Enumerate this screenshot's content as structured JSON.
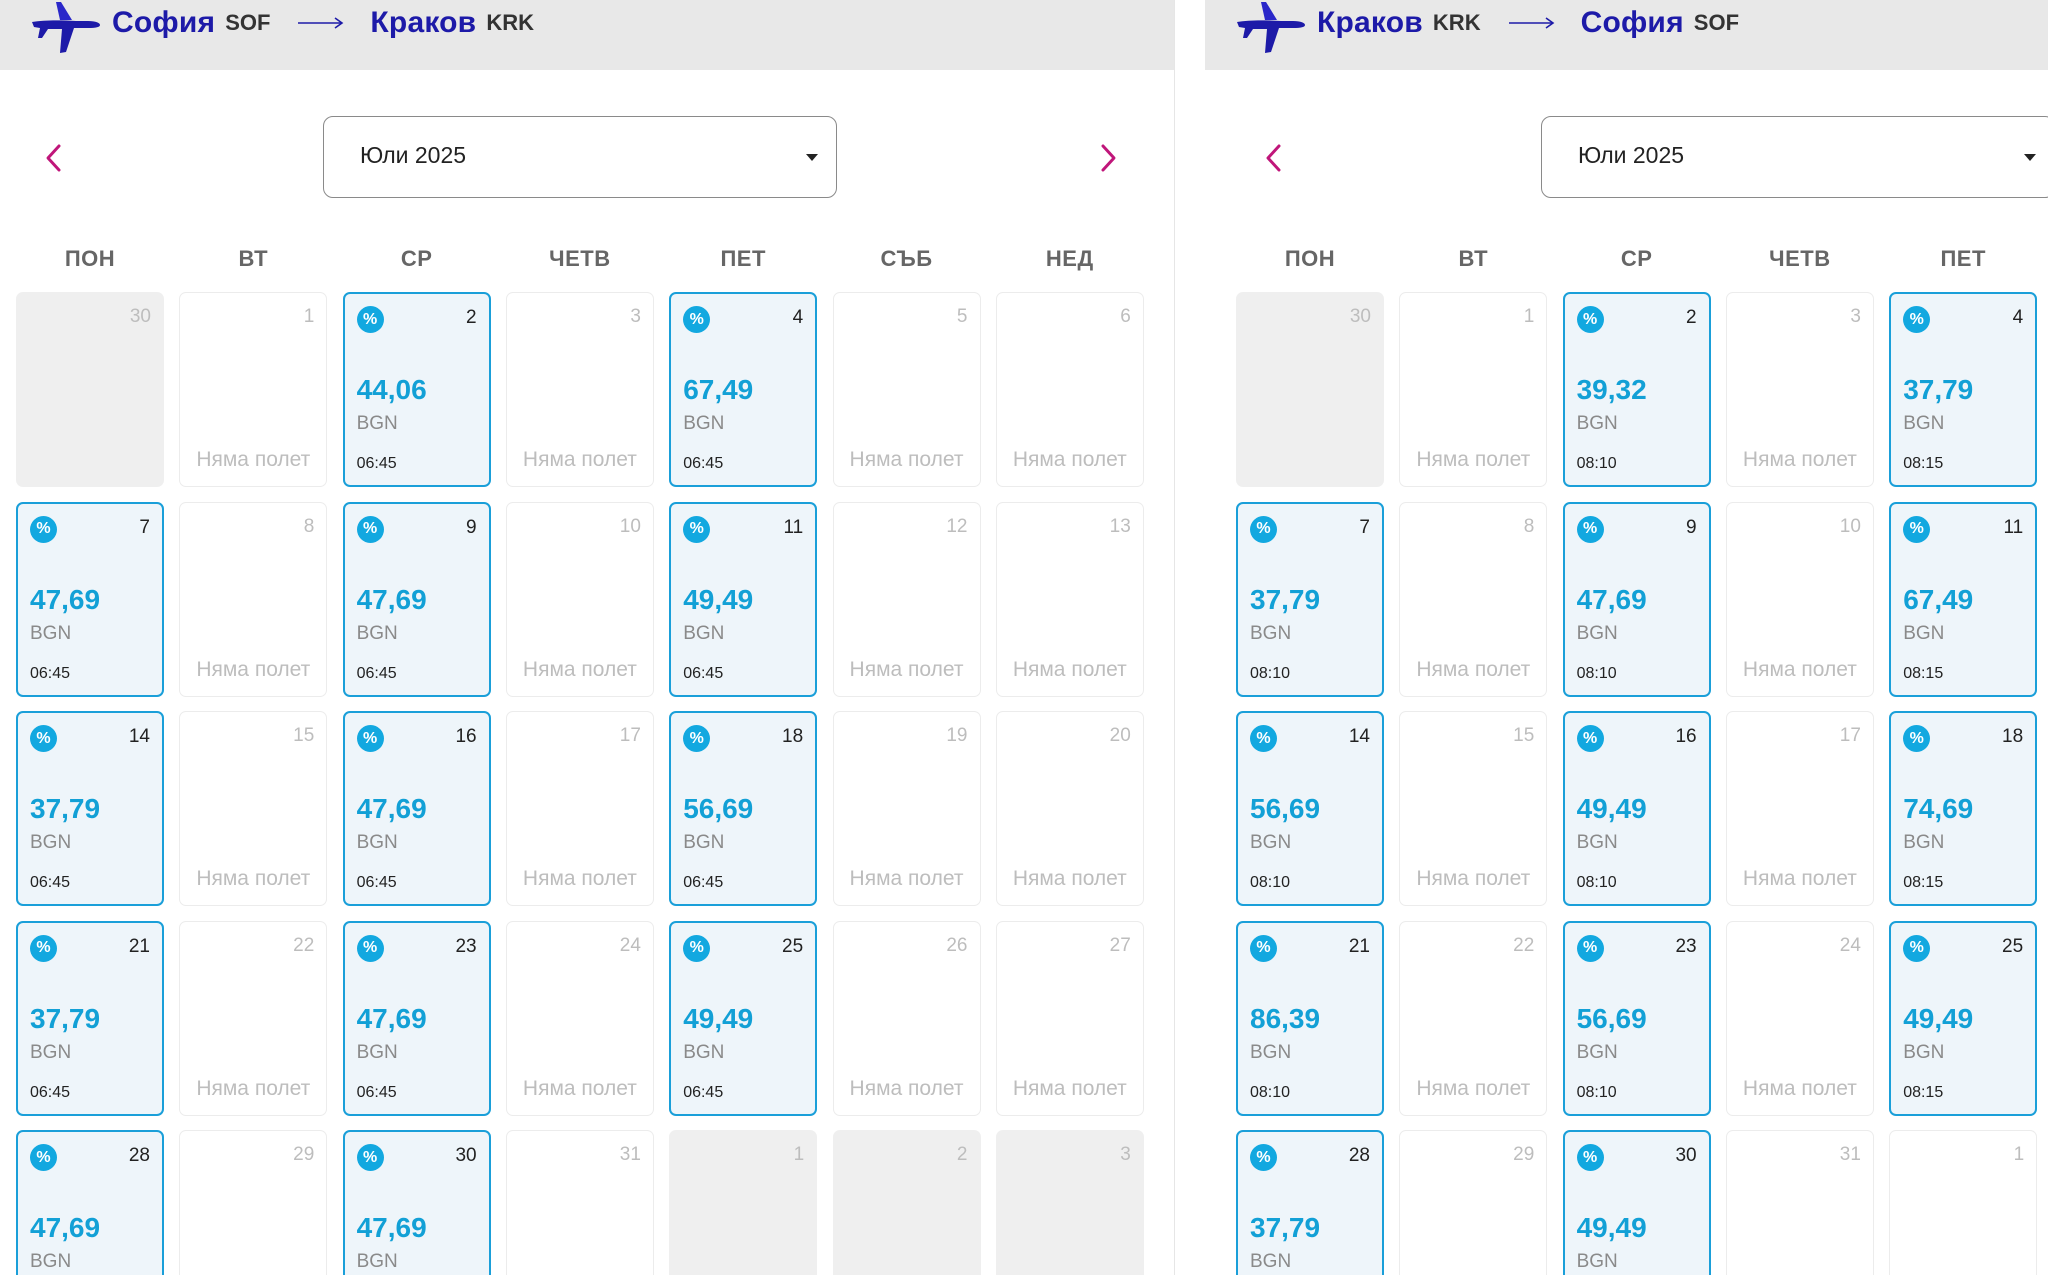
{
  "colors": {
    "accent": "#12a0d6",
    "brand": "#1d1aa8",
    "nav": "#c0167a",
    "header_bg": "#e8e8e8"
  },
  "no_flight_label": "Няма полет",
  "currency": "BGN",
  "discount_badge": "%",
  "panels": [
    {
      "origin_city": "София",
      "origin_code": "SOF",
      "dest_city": "Краков",
      "dest_code": "KRK",
      "month": "Юли 2025",
      "weekdays": [
        "ПОН",
        "ВТ",
        "СР",
        "ЧЕТВ",
        "ПЕТ",
        "СЪБ",
        "НЕД"
      ],
      "days": [
        {
          "day": "30",
          "state": "empty"
        },
        {
          "day": "1",
          "state": "none"
        },
        {
          "day": "2",
          "state": "flight",
          "price": "44,06",
          "time": "06:45"
        },
        {
          "day": "3",
          "state": "none"
        },
        {
          "day": "4",
          "state": "flight",
          "price": "67,49",
          "time": "06:45"
        },
        {
          "day": "5",
          "state": "none"
        },
        {
          "day": "6",
          "state": "none"
        },
        {
          "day": "7",
          "state": "flight",
          "price": "47,69",
          "time": "06:45"
        },
        {
          "day": "8",
          "state": "none"
        },
        {
          "day": "9",
          "state": "flight",
          "price": "47,69",
          "time": "06:45"
        },
        {
          "day": "10",
          "state": "none"
        },
        {
          "day": "11",
          "state": "flight",
          "price": "49,49",
          "time": "06:45"
        },
        {
          "day": "12",
          "state": "none"
        },
        {
          "day": "13",
          "state": "none"
        },
        {
          "day": "14",
          "state": "flight",
          "price": "37,79",
          "time": "06:45"
        },
        {
          "day": "15",
          "state": "none"
        },
        {
          "day": "16",
          "state": "flight",
          "price": "47,69",
          "time": "06:45"
        },
        {
          "day": "17",
          "state": "none"
        },
        {
          "day": "18",
          "state": "flight",
          "price": "56,69",
          "time": "06:45"
        },
        {
          "day": "19",
          "state": "none"
        },
        {
          "day": "20",
          "state": "none"
        },
        {
          "day": "21",
          "state": "flight",
          "price": "37,79",
          "time": "06:45"
        },
        {
          "day": "22",
          "state": "none"
        },
        {
          "day": "23",
          "state": "flight",
          "price": "47,69",
          "time": "06:45"
        },
        {
          "day": "24",
          "state": "none"
        },
        {
          "day": "25",
          "state": "flight",
          "price": "49,49",
          "time": "06:45"
        },
        {
          "day": "26",
          "state": "none"
        },
        {
          "day": "27",
          "state": "none"
        },
        {
          "day": "28",
          "state": "flight",
          "price": "47,69",
          "time": ""
        },
        {
          "day": "29",
          "state": "none"
        },
        {
          "day": "30",
          "state": "flight",
          "price": "47,69",
          "time": ""
        },
        {
          "day": "31",
          "state": "none"
        },
        {
          "day": "1",
          "state": "empty"
        },
        {
          "day": "2",
          "state": "empty"
        },
        {
          "day": "3",
          "state": "empty"
        }
      ]
    },
    {
      "origin_city": "Краков",
      "origin_code": "KRK",
      "dest_city": "София",
      "dest_code": "SOF",
      "month": "Юли 2025",
      "weekdays": [
        "ПОН",
        "ВТ",
        "СР",
        "ЧЕТВ",
        "ПЕТ"
      ],
      "days": [
        {
          "day": "30",
          "state": "empty"
        },
        {
          "day": "1",
          "state": "none"
        },
        {
          "day": "2",
          "state": "flight",
          "price": "39,32",
          "time": "08:10"
        },
        {
          "day": "3",
          "state": "none"
        },
        {
          "day": "4",
          "state": "flight",
          "price": "37,79",
          "time": "08:15"
        },
        {
          "day": "7",
          "state": "flight",
          "price": "37,79",
          "time": "08:10"
        },
        {
          "day": "8",
          "state": "none"
        },
        {
          "day": "9",
          "state": "flight",
          "price": "47,69",
          "time": "08:10"
        },
        {
          "day": "10",
          "state": "none"
        },
        {
          "day": "11",
          "state": "flight",
          "price": "67,49",
          "time": "08:15"
        },
        {
          "day": "14",
          "state": "flight",
          "price": "56,69",
          "time": "08:10"
        },
        {
          "day": "15",
          "state": "none"
        },
        {
          "day": "16",
          "state": "flight",
          "price": "49,49",
          "time": "08:10"
        },
        {
          "day": "17",
          "state": "none"
        },
        {
          "day": "18",
          "state": "flight",
          "price": "74,69",
          "time": "08:15"
        },
        {
          "day": "21",
          "state": "flight",
          "price": "86,39",
          "time": "08:10"
        },
        {
          "day": "22",
          "state": "none"
        },
        {
          "day": "23",
          "state": "flight",
          "price": "56,69",
          "time": "08:10"
        },
        {
          "day": "24",
          "state": "none"
        },
        {
          "day": "25",
          "state": "flight",
          "price": "49,49",
          "time": "08:15"
        },
        {
          "day": "28",
          "state": "flight",
          "price": "37,79",
          "time": ""
        },
        {
          "day": "29",
          "state": "none"
        },
        {
          "day": "30",
          "state": "flight",
          "price": "49,49",
          "time": ""
        },
        {
          "day": "31",
          "state": "none"
        },
        {
          "day": "1",
          "state": "none"
        }
      ]
    }
  ]
}
